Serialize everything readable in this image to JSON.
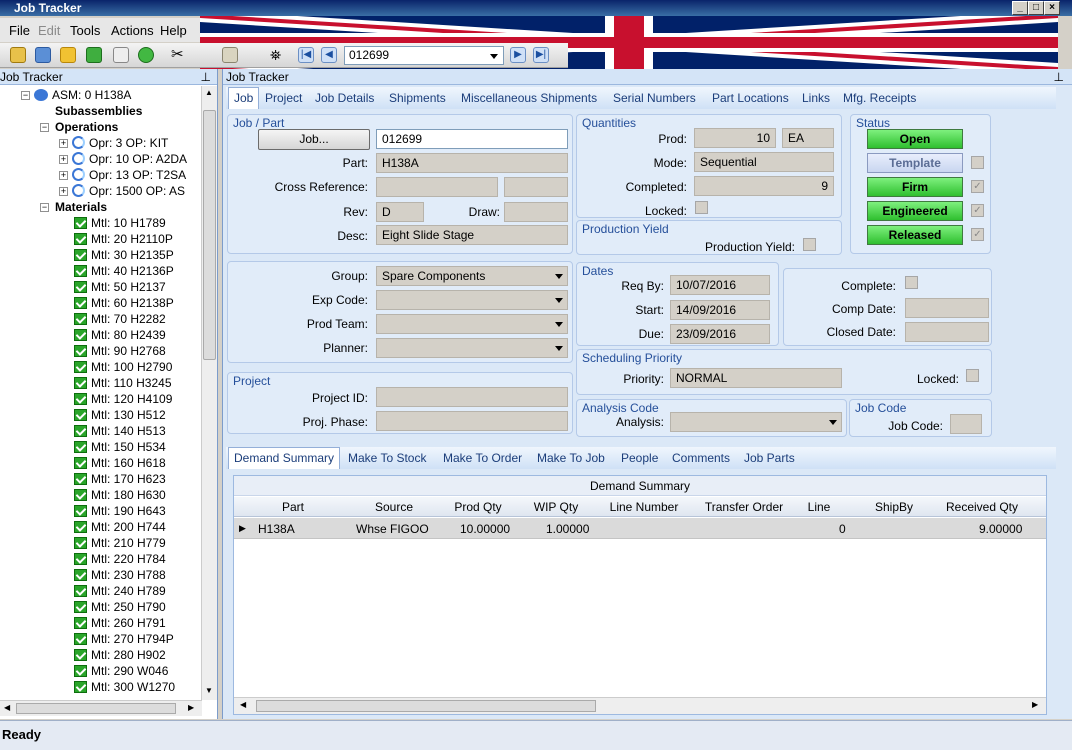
{
  "app": {
    "title": "Job Tracker"
  },
  "menu": [
    "File",
    "Edit",
    "Tools",
    "Actions",
    "Help"
  ],
  "toolbar": {
    "job_combo": "012699"
  },
  "left_panel": {
    "title": "Job Tracker",
    "asm": "ASM: 0 H138A",
    "subassemblies": "Subassemblies",
    "operations_label": "Operations",
    "operations": [
      "Opr: 3 OP: KIT",
      "Opr: 10 OP: A2DA",
      "Opr: 13 OP: T2SA",
      "Opr: 1500 OP: AS"
    ],
    "materials_label": "Materials",
    "materials": [
      "Mtl: 10 H1789",
      "Mtl: 20 H2110P",
      "Mtl: 30 H2135P",
      "Mtl: 40 H2136P",
      "Mtl: 50 H2137",
      "Mtl: 60 H2138P",
      "Mtl: 70 H2282",
      "Mtl: 80 H2439",
      "Mtl: 90 H2768",
      "Mtl: 100 H2790",
      "Mtl: 110 H3245",
      "Mtl: 120 H4109",
      "Mtl: 130 H512",
      "Mtl: 140 H513",
      "Mtl: 150 H534",
      "Mtl: 160 H618",
      "Mtl: 170 H623",
      "Mtl: 180 H630",
      "Mtl: 190 H643",
      "Mtl: 200 H744",
      "Mtl: 210 H779",
      "Mtl: 220 H784",
      "Mtl: 230 H788",
      "Mtl: 240 H789",
      "Mtl: 250 H790",
      "Mtl: 260 H791",
      "Mtl: 270 H794P",
      "Mtl: 280 H902",
      "Mtl: 290 W046",
      "Mtl: 300 W1270"
    ]
  },
  "main": {
    "title": "Job Tracker",
    "tabs": [
      "Job",
      "Project",
      "Job Details",
      "Shipments",
      "Miscellaneous Shipments",
      "Serial Numbers",
      "Part Locations",
      "Links",
      "Mfg. Receipts"
    ],
    "job_part": {
      "group_title": "Job / Part",
      "job_button": "Job...",
      "job": "012699",
      "part_label": "Part:",
      "part": "H138A",
      "xref_label": "Cross Reference:",
      "rev_label": "Rev:",
      "rev": "D",
      "draw_label": "Draw:",
      "desc_label": "Desc:",
      "desc": "Eight Slide Stage"
    },
    "quantities": {
      "group_title": "Quantities",
      "prod_label": "Prod:",
      "prod": "10",
      "uom": "EA",
      "mode_label": "Mode:",
      "mode": "Sequential",
      "completed_label": "Completed:",
      "completed": "9",
      "locked_label": "Locked:"
    },
    "status": {
      "group_title": "Status",
      "open": "Open",
      "template": "Template",
      "firm": "Firm",
      "engineered": "Engineered",
      "released": "Released"
    },
    "production_yield": {
      "group_title": "Production Yield",
      "label": "Production Yield:"
    },
    "classification": {
      "group_label": "Group:",
      "group": "Spare Components",
      "exp_code_label": "Exp Code:",
      "prod_team_label": "Prod Team:",
      "planner_label": "Planner:"
    },
    "dates": {
      "group_title": "Dates",
      "req_by_label": "Req By:",
      "req_by": "10/07/2016",
      "start_label": "Start:",
      "start": "14/09/2016",
      "due_label": "Due:",
      "due": "23/09/2016"
    },
    "completion": {
      "complete_label": "Complete:",
      "comp_date_label": "Comp Date:",
      "closed_date_label": "Closed Date:"
    },
    "scheduling": {
      "group_title": "Scheduling Priority",
      "priority_label": "Priority:",
      "priority": "NORMAL",
      "locked_label": "Locked:"
    },
    "project": {
      "group_title": "Project",
      "project_id_label": "Project ID:",
      "phase_label": "Proj. Phase:"
    },
    "analysis": {
      "group_title": "Analysis Code",
      "label": "Analysis:"
    },
    "job_code": {
      "group_title": "Job Code",
      "label": "Job Code:"
    },
    "subtabs": [
      "Demand Summary",
      "Make To Stock",
      "Make To Order",
      "Make To Job",
      "People",
      "Comments",
      "Job Parts"
    ],
    "demand": {
      "caption": "Demand Summary",
      "columns": [
        "Part",
        "Source",
        "Prod Qty",
        "WIP Qty",
        "Line Number",
        "Transfer Order",
        "Line",
        "ShipBy",
        "Received Qty"
      ],
      "rows": [
        {
          "part": "H138A",
          "source": "Whse FIGOO",
          "prod_qty": "10.00000",
          "wip_qty": "1.00000",
          "line_number": "",
          "transfer_order": "",
          "line": "0",
          "ship_by": "",
          "received_qty": "9.00000"
        }
      ]
    }
  },
  "status_bar": {
    "text": "Ready"
  }
}
